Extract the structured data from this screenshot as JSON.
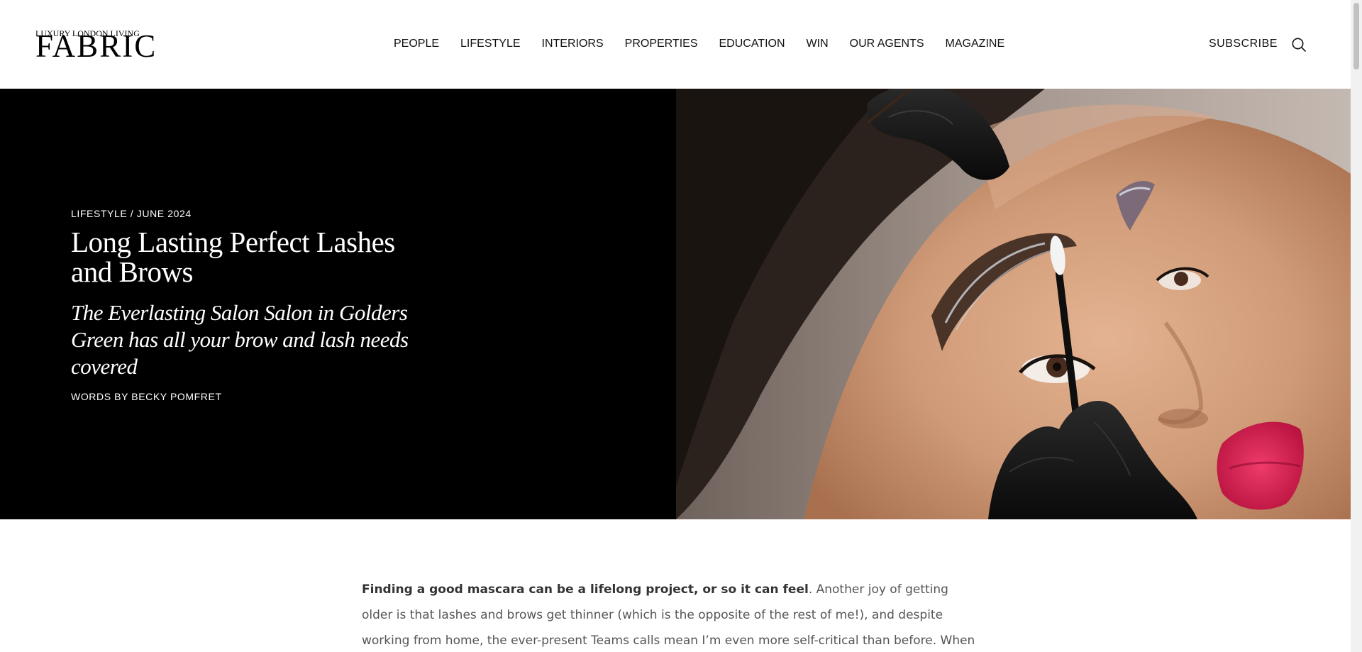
{
  "header": {
    "logo_tagline": "LUXURY LONDON LIVING",
    "logo_word": "FABRIC",
    "nav": [
      "PEOPLE",
      "LIFESTYLE",
      "INTERIORS",
      "PROPERTIES",
      "EDUCATION",
      "WIN",
      "OUR AGENTS",
      "MAGAZINE"
    ],
    "subscribe": "SUBSCRIBE",
    "search_icon": "search-icon"
  },
  "hero": {
    "meta": "LIFESTYLE / JUNE 2024",
    "title": "Long Lasting Perfect Lashes and Brows",
    "subtitle": "The Everlasting Salon Salon in Golders Green has all your brow and lash needs covered",
    "byline": "WORDS BY BECKY POMFRET",
    "image_alt": "Woman having brow lamination treatment with gloved hands applying product"
  },
  "article": {
    "lead_bold": "Finding a good mascara can be a lifelong project, or so it can feel",
    "lead_rest": ". Another joy of getting older is that lashes and brows get thinner (which is the opposite of the rest of me!), and despite working from home, the ever-present Teams calls mean I’m even more self-critical than before. When I hear about a new speedy eyelash"
  },
  "colors": {
    "hero_background": "#000000",
    "lipstick": "#d0184a",
    "glove": "#111111"
  }
}
